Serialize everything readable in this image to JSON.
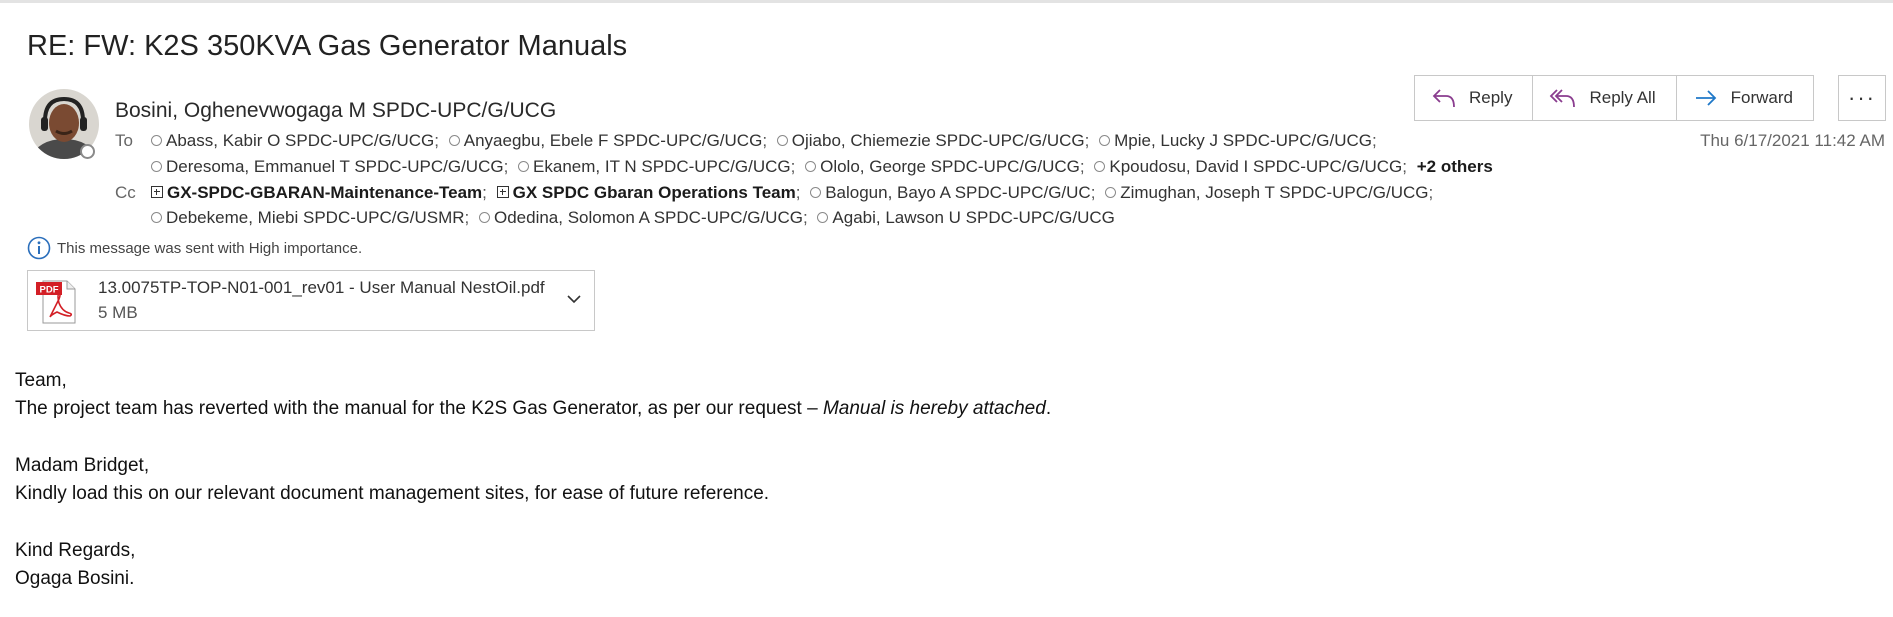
{
  "email": {
    "subject": "RE: FW: K2S 350KVA Gas Generator Manuals",
    "sender": "Bosini, Oghenevwogaga M SPDC-UPC/G/UCG",
    "date": "Thu 6/17/2021 11:42 AM",
    "to_label": "To",
    "cc_label": "Cc",
    "to": [
      "Abass, Kabir O SPDC-UPC/G/UCG",
      "Anyaegbu, Ebele F SPDC-UPC/G/UCG",
      "Ojiabo, Chiemezie SPDC-UPC/G/UCG",
      "Mpie, Lucky J SPDC-UPC/G/UCG",
      "Deresoma, Emmanuel T SPDC-UPC/G/UCG",
      "Ekanem, IT N SPDC-UPC/G/UCG",
      "Ololo, George SPDC-UPC/G/UCG",
      "Kpoudosu, David I SPDC-UPC/G/UCG"
    ],
    "to_more": "+2 others",
    "cc_groups": [
      "GX-SPDC-GBARAN-Maintenance-Team",
      "GX SPDC Gbaran Operations Team"
    ],
    "cc": [
      "Balogun, Bayo A SPDC-UPC/G/UC",
      "Zimughan, Joseph T SPDC-UPC/G/UCG",
      "Debekeme, Miebi SPDC-UPC/G/USMR",
      "Odedina, Solomon A SPDC-UPC/G/UCG",
      "Agabi, Lawson U SPDC-UPC/G/UCG"
    ],
    "importance": "This message was sent with High importance.",
    "attachment": {
      "name": "13.0075TP-TOP-N01-001_rev01 - User Manual NestOil.pdf",
      "size": "5 MB",
      "icon_label": "PDF"
    },
    "body": {
      "l1": "Team,",
      "l2a": "The project team has reverted with the manual for the K2S Gas Generator, as per our request – ",
      "l2b": "Manual is hereby attached",
      "l2c": ".",
      "l3": "Madam Bridget,",
      "l4": "Kindly load this on our relevant document management sites, for ease of future reference.",
      "l5": "Kind Regards,",
      "l6": "Ogaga Bosini."
    }
  },
  "actions": {
    "reply": "Reply",
    "reply_all": "Reply All",
    "forward": "Forward",
    "more": "···"
  },
  "colors": {
    "reply_icon": "#8a3d8f",
    "forward_icon": "#1f78c8",
    "info_icon": "#2a6ebb",
    "pdf_red": "#d31f26"
  }
}
